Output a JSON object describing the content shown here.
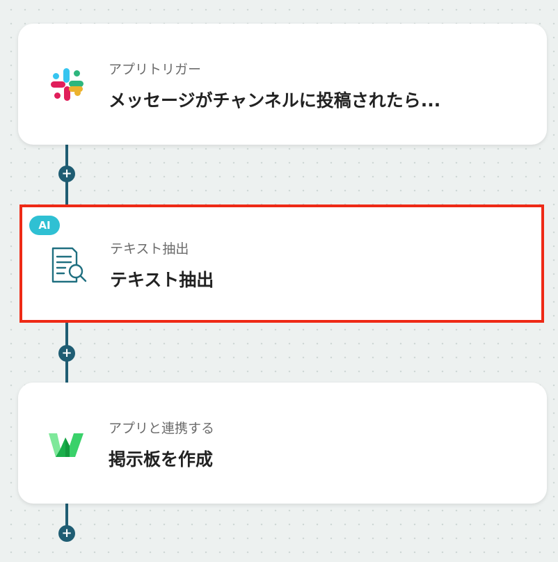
{
  "flow": {
    "steps": [
      {
        "subtitle": "アプリトリガー",
        "title": "メッセージがチャンネルに投稿されたら...",
        "icon": "slack-icon"
      },
      {
        "badge": "AI",
        "subtitle": "テキスト抽出",
        "title": "テキスト抽出",
        "icon": "document-search-icon",
        "selected": true
      },
      {
        "subtitle": "アプリと連携する",
        "title": "掲示板を作成",
        "icon": "w-logo-icon"
      }
    ],
    "add_step_label": "+"
  },
  "colors": {
    "connector": "#1f5d73",
    "selection_border": "#ee2a16",
    "ai_badge": "#2fc0d3",
    "background": "#edf1f0"
  }
}
